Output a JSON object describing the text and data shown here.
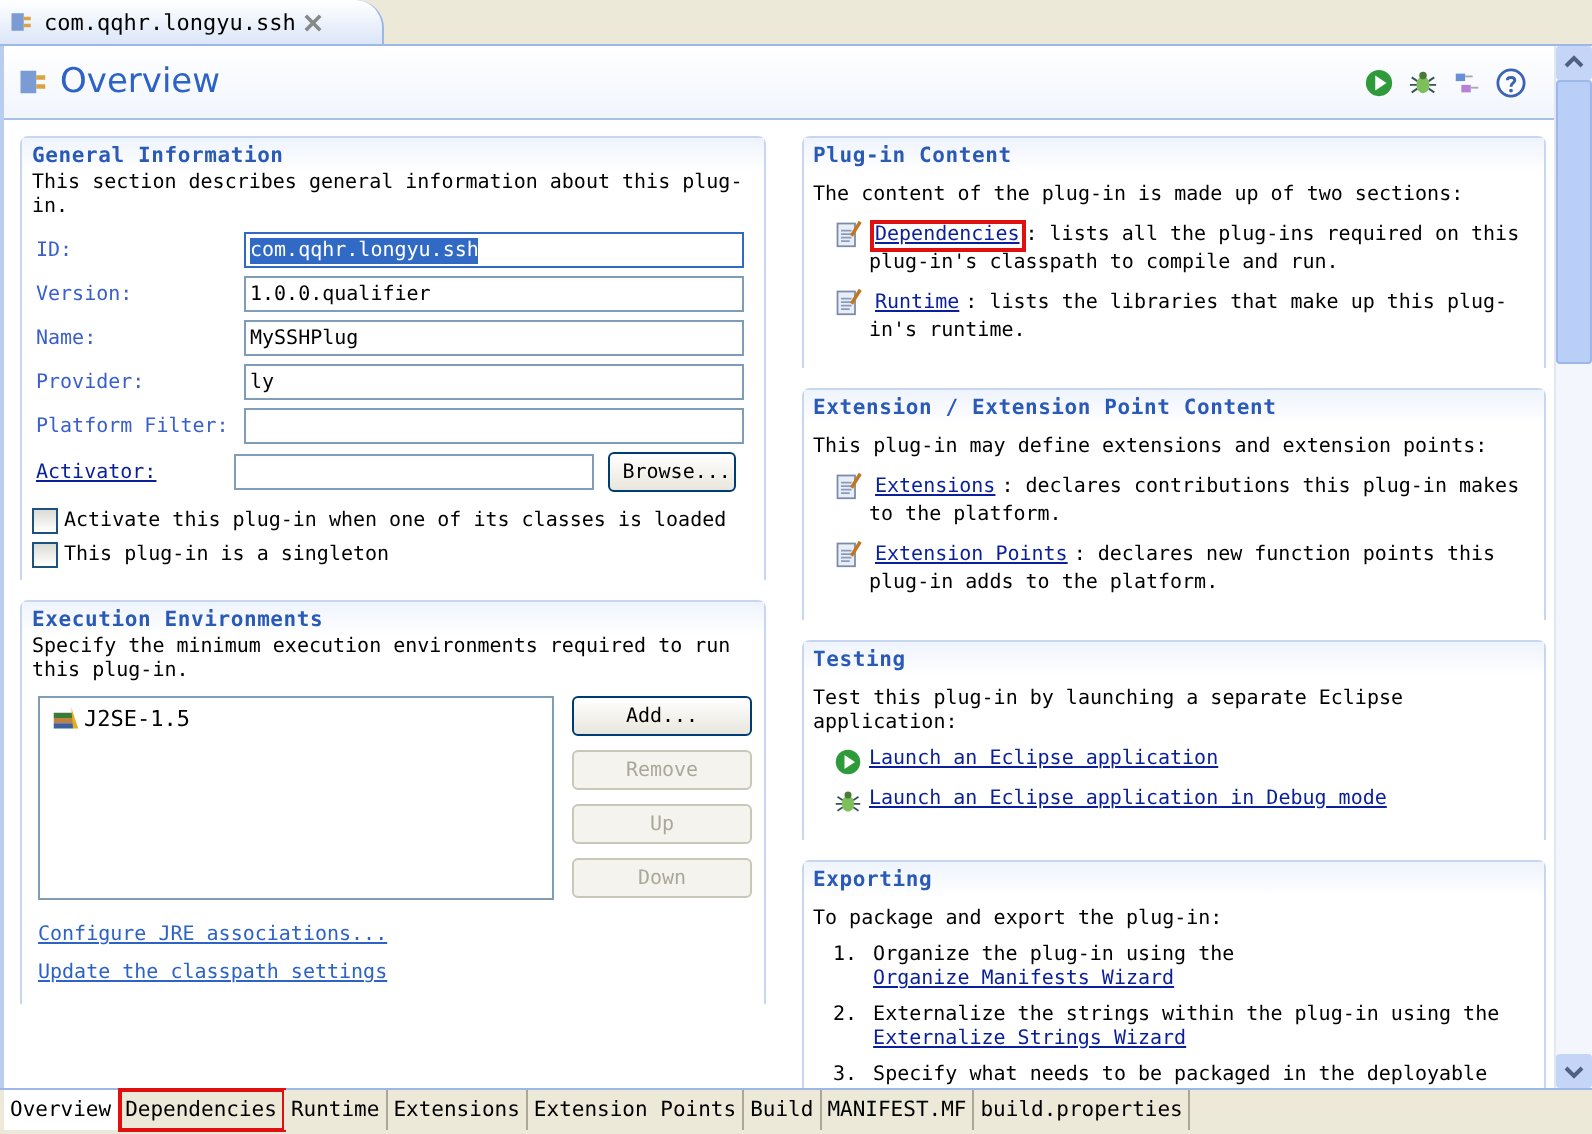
{
  "editor_tab": {
    "title": "com.qqhr.longyu.ssh"
  },
  "header": {
    "title": "Overview"
  },
  "general_information": {
    "title": "General Information",
    "description": "This section describes general information about this plug-in.",
    "fields": [
      {
        "label": "ID:",
        "value": "com.qqhr.longyu.ssh",
        "selected": true
      },
      {
        "label": "Version:",
        "value": "1.0.0.qualifier",
        "selected": false
      },
      {
        "label": "Name:",
        "value": "MySSHPlug",
        "selected": false
      },
      {
        "label": "Provider:",
        "value": "ly",
        "selected": false
      },
      {
        "label": "Platform Filter:",
        "selected": false
      }
    ],
    "activator": {
      "label": "Activator:",
      "button": "Browse..."
    },
    "checkboxes": [
      {
        "label": "Activate this plug-in when one of its classes is loaded",
        "checked": false
      },
      {
        "label": "This plug-in is a singleton",
        "checked": false
      }
    ]
  },
  "execution_environments": {
    "title": "Execution Environments",
    "description": "Specify the minimum execution environments required to run this plug-in.",
    "environments": [
      "J2SE-1.5"
    ],
    "buttons": [
      {
        "label": "Add...",
        "disabled": false
      },
      {
        "label": "Remove",
        "disabled": true
      },
      {
        "label": "Up",
        "disabled": true
      },
      {
        "label": "Down",
        "disabled": true
      }
    ],
    "links": [
      "Configure JRE associations...",
      "Update the classpath settings"
    ]
  },
  "plugin_content": {
    "title": "Plug-in Content",
    "intro": "The content of the plug-in is made up of two sections:",
    "items": [
      {
        "link": "Dependencies",
        "text": ": lists all the plug-ins required on this plug-in's classpath to compile and run.",
        "highlighted": true
      },
      {
        "link": "Runtime",
        "text": ": lists the libraries that make up this plug-in's runtime.",
        "highlighted": false
      }
    ]
  },
  "extension_content": {
    "title": "Extension / Extension Point Content",
    "intro": "This plug-in may define extensions and extension points:",
    "items": [
      {
        "link": "Extensions",
        "text": ": declares contributions this plug-in makes to the platform.",
        "highlighted": false
      },
      {
        "link": "Extension Points",
        "text": ": declares new function points this plug-in adds to the platform.",
        "highlighted": false
      }
    ]
  },
  "testing": {
    "title": "Testing",
    "intro": "Test this plug-in by launching a separate Eclipse application:",
    "links": [
      {
        "kind": "run",
        "label": "Launch an Eclipse application"
      },
      {
        "kind": "debug",
        "label": "Launch an Eclipse application in Debug mode"
      }
    ]
  },
  "exporting": {
    "title": "Exporting",
    "intro": "To package and export the plug-in:",
    "steps": [
      {
        "number": "1.",
        "text": "Organize the plug-in using the",
        "link": "Organize Manifests Wizard"
      },
      {
        "number": "2.",
        "text": "Externalize the strings within the plug-in using the",
        "link": "Externalize Strings Wizard"
      },
      {
        "number": "3.",
        "text": "Specify what needs to be packaged in the deployable"
      }
    ]
  },
  "page_tabs": [
    {
      "label": "Overview",
      "selected": true,
      "highlighted": false
    },
    {
      "label": "Dependencies",
      "selected": false,
      "highlighted": true
    },
    {
      "label": "Runtime",
      "selected": false,
      "highlighted": false
    },
    {
      "label": "Extensions",
      "selected": false,
      "highlighted": false
    },
    {
      "label": "Extension Points",
      "selected": false,
      "highlighted": false
    },
    {
      "label": "Build",
      "selected": false,
      "highlighted": false
    },
    {
      "label": "MANIFEST.MF",
      "selected": false,
      "highlighted": false
    },
    {
      "label": "build.properties",
      "selected": false,
      "highlighted": false
    }
  ]
}
